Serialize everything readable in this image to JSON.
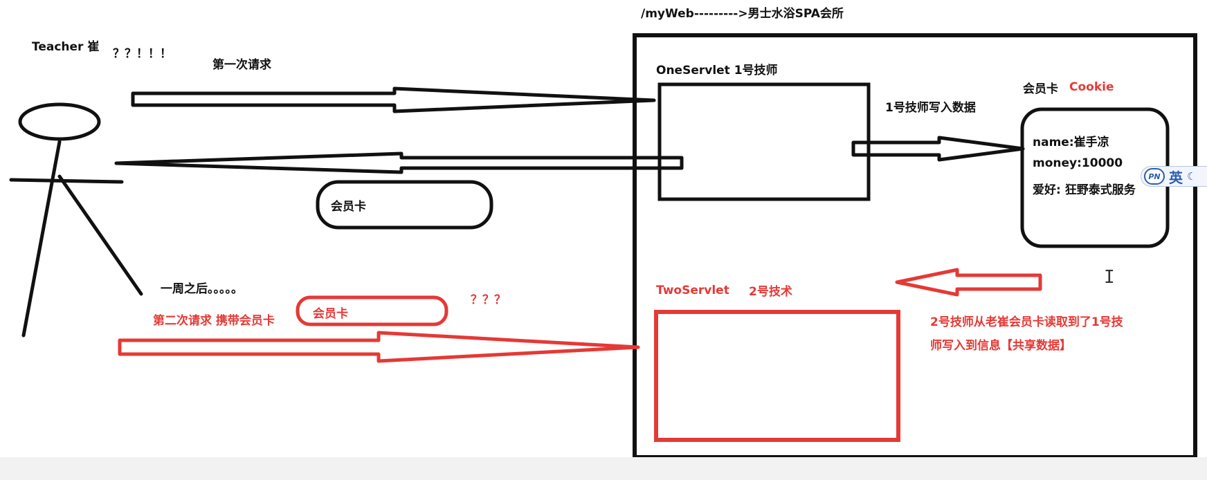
{
  "header": {
    "path_label": "/myWeb--------->男士水浴SPA会所"
  },
  "client": {
    "name_label": "Teacher 崔",
    "exclaim": "？？！！！"
  },
  "requests": {
    "first_request": "第一次请求",
    "card_label_1": "会员卡",
    "week_later": "一周之后。。。。。",
    "second_request": "第二次请求 携带会员卡",
    "card_label_2": "会员卡",
    "question_marks": "？？？"
  },
  "server": {
    "one_servlet_label": "OneServlet  1号技师",
    "write_data_label": "1号技师写入数据",
    "card_title": "会员卡",
    "cookie_label": "Cookie",
    "card_lines": [
      "name:崔手凉",
      "money:10000",
      "爱好: 狂野泰式服务"
    ],
    "two_servlet_label": "TwoServlet",
    "tech2_label": "2号技术",
    "read_note_line1": "2号技师从老崔会员卡读取到了1号技",
    "read_note_line2": "师写入到信息【共享数据】"
  },
  "ime": {
    "logo_text": "PN",
    "lang_label": "英",
    "mode_icon": "moon-icon"
  },
  "colors": {
    "black": "#111111",
    "red": "#e53935"
  }
}
